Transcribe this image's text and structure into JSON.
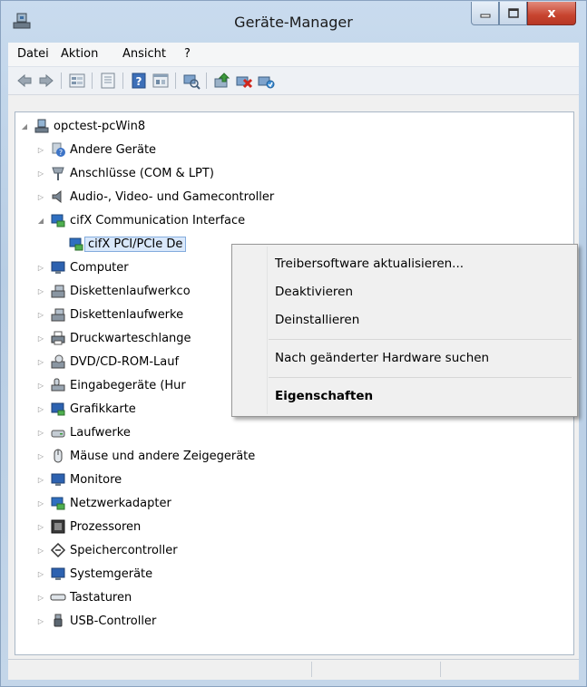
{
  "window": {
    "title": "Geräte-Manager",
    "controls": {
      "minimize": "_",
      "maximize": "□",
      "close": "x"
    }
  },
  "menubar": {
    "items": [
      "Datei",
      "Aktion",
      "Ansicht",
      "?"
    ]
  },
  "toolbar": {
    "buttons": [
      "back-icon",
      "forward-icon",
      "properties-grid-icon",
      "console-tree-icon",
      "help-icon",
      "resources-icon",
      "scan-hardware-icon",
      "update-driver-icon",
      "uninstall-icon",
      "enable-device-icon"
    ]
  },
  "tree": {
    "root": "opctest-pcWin8",
    "items": [
      "Andere Geräte",
      "Anschlüsse (COM & LPT)",
      "Audio-, Video- und Gamecontroller",
      "cifX Communication Interface",
      "cifX PCI/PCIe De",
      "Computer",
      "Diskettenlaufwerkco",
      "Diskettenlaufwerke",
      "Druckwarteschlange",
      "DVD/CD-ROM-Lauf",
      "Eingabegeräte (Hur",
      "Grafikkarte",
      "Laufwerke",
      "Mäuse und andere Zeigegeräte",
      "Monitore",
      "Netzwerkadapter",
      "Prozessoren",
      "Speichercontroller",
      "Systemgeräte",
      "Tastaturen",
      "USB-Controller"
    ]
  },
  "context_menu": {
    "items": [
      "Treibersoftware aktualisieren...",
      "Deaktivieren",
      "Deinstallieren",
      "Nach geänderter Hardware suchen",
      "Eigenschaften"
    ]
  },
  "colors": {
    "selection": "#d9e8fb",
    "selection_border": "#84acdd",
    "close_button": "#c7442f"
  }
}
